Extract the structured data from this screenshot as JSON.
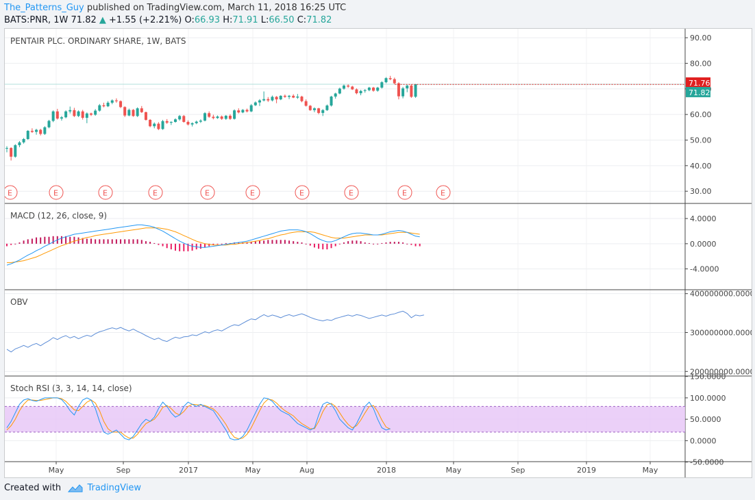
{
  "header": {
    "author": "The_Patterns_Guy",
    "published": "published on TradingView.com, March 11, 2018 16:25 UTC",
    "symbol": "BATS:PNR, 1W",
    "last": "71.82",
    "change": "+1.55 (+2.21%)",
    "o_label": "O:",
    "o_val": "66.93",
    "h_label": "H:",
    "h_val": "71.91",
    "l_label": "L:",
    "l_val": "66.50",
    "c_label": "C:",
    "c_val": "71.82"
  },
  "footer": {
    "created": "Created with",
    "brand": "TradingView"
  },
  "colors": {
    "up": "#26a69a",
    "down": "#ef5350",
    "macd": "#2196f3",
    "signal": "#ff9800",
    "hist_neg": "#e91e63",
    "hist_pos": "#c2185b",
    "obv": "#5b8cd6",
    "band_fill": "#e7c8f7",
    "band_line": "#9c5fc2",
    "earnings": "#ef5350",
    "last_price": "#26a69a",
    "prev_close": "#e02020"
  },
  "chart_data": [
    {
      "pane": "price",
      "type": "candlestick",
      "title": "PENTAIR PLC. ORDINARY SHARE, 1W, BATS",
      "y_ticks": [
        "90.00",
        "80.00",
        "70.00",
        "60.00",
        "50.00",
        "40.00",
        "30.00"
      ],
      "y_values": [
        90,
        80,
        70,
        60,
        50,
        40,
        30
      ],
      "ylim": [
        25.5,
        93.5
      ],
      "x_ticks": [
        "May",
        "Sep",
        "2017",
        "May",
        "Aug",
        "2018",
        "May",
        "Sep",
        "2019",
        "May"
      ],
      "last_price_label": "71.82",
      "prev_close_label": "71.76",
      "earnings_marker": "E",
      "earnings_count": 10,
      "candles": [
        [
          46.8,
          47.6,
          45.2,
          46.9
        ],
        [
          46.9,
          47.2,
          42.0,
          43.5
        ],
        [
          43.5,
          48.4,
          43.1,
          48.0
        ],
        [
          48.0,
          49.6,
          47.2,
          49.1
        ],
        [
          49.1,
          50.8,
          48.6,
          50.4
        ],
        [
          50.4,
          53.9,
          50.1,
          53.6
        ],
        [
          53.6,
          54.6,
          52.8,
          53.2
        ],
        [
          53.2,
          54.4,
          52.1,
          54.0
        ],
        [
          54.0,
          54.4,
          51.8,
          52.4
        ],
        [
          52.4,
          55.4,
          52.0,
          55.0
        ],
        [
          55.0,
          57.9,
          54.6,
          57.5
        ],
        [
          57.5,
          61.6,
          57.0,
          61.2
        ],
        [
          61.2,
          62.2,
          58.0,
          58.4
        ],
        [
          58.4,
          59.4,
          57.6,
          58.9
        ],
        [
          58.9,
          61.6,
          58.5,
          61.2
        ],
        [
          61.2,
          63.1,
          60.4,
          61.7
        ],
        [
          61.7,
          62.6,
          59.0,
          59.4
        ],
        [
          59.4,
          61.6,
          59.0,
          61.2
        ],
        [
          61.2,
          61.8,
          58.0,
          58.7
        ],
        [
          58.7,
          60.8,
          56.6,
          60.4
        ],
        [
          60.4,
          60.7,
          59.4,
          59.9
        ],
        [
          59.9,
          62.1,
          59.5,
          61.5
        ],
        [
          61.5,
          64.1,
          61.1,
          63.6
        ],
        [
          63.6,
          64.6,
          62.8,
          63.2
        ],
        [
          63.2,
          65.2,
          62.9,
          64.6
        ],
        [
          64.6,
          65.9,
          64.0,
          65.5
        ],
        [
          65.5,
          66.3,
          64.6,
          65.2
        ],
        [
          65.2,
          65.5,
          62.5,
          62.9
        ],
        [
          62.9,
          63.2,
          59.0,
          59.6
        ],
        [
          59.6,
          62.3,
          59.3,
          61.8
        ],
        [
          61.8,
          62.1,
          59.1,
          59.4
        ],
        [
          59.4,
          62.8,
          59.0,
          62.4
        ],
        [
          62.4,
          63.3,
          60.6,
          60.9
        ],
        [
          60.9,
          61.1,
          57.6,
          57.9
        ],
        [
          57.9,
          58.2,
          55.0,
          55.4
        ],
        [
          55.4,
          56.9,
          54.6,
          56.4
        ],
        [
          56.4,
          57.0,
          53.9,
          54.3
        ],
        [
          54.3,
          57.9,
          54.0,
          57.4
        ],
        [
          57.4,
          58.2,
          56.3,
          56.8
        ],
        [
          56.8,
          57.3,
          55.9,
          57.1
        ],
        [
          57.1,
          58.5,
          56.8,
          58.1
        ],
        [
          58.1,
          59.8,
          57.6,
          59.4
        ],
        [
          59.4,
          59.8,
          56.8,
          57.1
        ],
        [
          57.1,
          57.7,
          55.7,
          56.1
        ],
        [
          56.1,
          56.9,
          55.3,
          56.6
        ],
        [
          56.6,
          57.6,
          56.2,
          57.2
        ],
        [
          57.2,
          58.1,
          56.7,
          57.6
        ],
        [
          57.6,
          60.9,
          57.3,
          60.5
        ],
        [
          60.5,
          61.2,
          58.7,
          59.1
        ],
        [
          59.1,
          59.9,
          58.1,
          58.6
        ],
        [
          58.6,
          59.6,
          58.3,
          59.2
        ],
        [
          59.2,
          59.6,
          57.9,
          58.3
        ],
        [
          58.3,
          59.8,
          57.9,
          59.5
        ],
        [
          59.5,
          60.1,
          57.9,
          58.3
        ],
        [
          58.3,
          62.0,
          58.0,
          61.6
        ],
        [
          61.6,
          62.4,
          60.4,
          60.8
        ],
        [
          60.8,
          62.1,
          60.5,
          61.8
        ],
        [
          61.8,
          62.3,
          60.8,
          61.2
        ],
        [
          61.2,
          64.1,
          60.9,
          63.6
        ],
        [
          63.6,
          65.1,
          63.3,
          64.7
        ],
        [
          64.7,
          66.0,
          63.3,
          65.5
        ],
        [
          65.5,
          69.0,
          65.1,
          66.0
        ],
        [
          66.0,
          66.8,
          64.9,
          65.5
        ],
        [
          65.5,
          67.4,
          65.1,
          66.9
        ],
        [
          66.9,
          67.2,
          64.4,
          65.9
        ],
        [
          65.9,
          67.5,
          65.6,
          67.3
        ],
        [
          67.3,
          67.8,
          66.5,
          66.9
        ],
        [
          66.9,
          67.6,
          66.0,
          67.3
        ],
        [
          67.3,
          67.9,
          66.4,
          66.6
        ],
        [
          66.6,
          68.0,
          66.1,
          67.0
        ],
        [
          67.0,
          67.3,
          64.8,
          65.2
        ],
        [
          65.2,
          65.9,
          63.1,
          63.4
        ],
        [
          63.4,
          63.7,
          61.4,
          61.7
        ],
        [
          61.7,
          62.8,
          60.9,
          62.4
        ],
        [
          62.4,
          62.6,
          60.1,
          60.6
        ],
        [
          60.6,
          62.1,
          59.4,
          61.7
        ],
        [
          61.7,
          63.9,
          61.4,
          63.5
        ],
        [
          63.5,
          67.3,
          63.1,
          67.0
        ],
        [
          67.0,
          68.5,
          66.2,
          68.2
        ],
        [
          68.2,
          70.5,
          67.9,
          70.1
        ],
        [
          70.1,
          71.7,
          69.7,
          71.3
        ],
        [
          71.3,
          71.8,
          70.4,
          70.9
        ],
        [
          70.9,
          71.2,
          69.6,
          69.8
        ],
        [
          69.8,
          70.2,
          67.9,
          68.3
        ],
        [
          68.3,
          69.6,
          67.5,
          69.2
        ],
        [
          69.2,
          69.9,
          68.5,
          69.5
        ],
        [
          69.5,
          70.8,
          69.1,
          70.5
        ],
        [
          70.5,
          70.8,
          68.9,
          69.3
        ],
        [
          69.3,
          70.8,
          68.9,
          70.5
        ],
        [
          70.5,
          73.0,
          70.1,
          72.6
        ],
        [
          72.6,
          74.6,
          72.2,
          74.2
        ],
        [
          74.2,
          75.1,
          73.4,
          73.8
        ],
        [
          73.8,
          74.4,
          71.8,
          72.2
        ],
        [
          72.2,
          72.6,
          65.9,
          67.1
        ],
        [
          67.1,
          70.8,
          66.3,
          70.2
        ],
        [
          70.2,
          71.6,
          68.7,
          71.3
        ],
        [
          71.3,
          71.8,
          66.5,
          66.9
        ],
        [
          66.93,
          71.91,
          66.5,
          71.82
        ]
      ]
    },
    {
      "pane": "macd",
      "type": "line",
      "title": "MACD (12, 26, close, 9)",
      "y_ticks": [
        "4.0000",
        "0.0000",
        "-4.0000"
      ],
      "y_values": [
        4,
        0,
        -4
      ],
      "ylim": [
        -7.2,
        6.4
      ],
      "series": [
        {
          "key": "macd",
          "values": [
            -3.4,
            -3.2,
            -2.9,
            -2.6,
            -2.2,
            -1.8,
            -1.5,
            -1.1,
            -0.8,
            -0.4,
            -0.1,
            0.3,
            0.6,
            0.9,
            1.1,
            1.3,
            1.5,
            1.6,
            1.7,
            1.8,
            1.9,
            2.0,
            2.1,
            2.2,
            2.3,
            2.4,
            2.5,
            2.6,
            2.7,
            2.8,
            2.9,
            3.0,
            3.0,
            2.9,
            2.8,
            2.6,
            2.3,
            2.0,
            1.6,
            1.2,
            0.8,
            0.4,
            0.1,
            -0.2,
            -0.4,
            -0.5,
            -0.6,
            -0.6,
            -0.5,
            -0.4,
            -0.3,
            -0.2,
            -0.1,
            0.0,
            0.1,
            0.2,
            0.3,
            0.4,
            0.6,
            0.8,
            1.0,
            1.2,
            1.4,
            1.6,
            1.8,
            2.0,
            2.1,
            2.2,
            2.2,
            2.2,
            2.1,
            1.9,
            1.6,
            1.2,
            0.8,
            0.5,
            0.3,
            0.3,
            0.5,
            0.8,
            1.1,
            1.4,
            1.6,
            1.7,
            1.7,
            1.6,
            1.5,
            1.4,
            1.4,
            1.5,
            1.7,
            1.9,
            2.0,
            2.1,
            2.0,
            1.8,
            1.5,
            1.2,
            1.1
          ]
        },
        {
          "key": "signal",
          "values": [
            -3.0,
            -3.0,
            -2.9,
            -2.8,
            -2.7,
            -2.5,
            -2.3,
            -2.1,
            -1.8,
            -1.5,
            -1.2,
            -0.9,
            -0.6,
            -0.3,
            -0.1,
            0.2,
            0.4,
            0.6,
            0.8,
            1.0,
            1.1,
            1.3,
            1.4,
            1.5,
            1.6,
            1.7,
            1.8,
            1.9,
            2.0,
            2.1,
            2.2,
            2.3,
            2.4,
            2.5,
            2.5,
            2.5,
            2.5,
            2.4,
            2.3,
            2.1,
            1.9,
            1.6,
            1.3,
            1.0,
            0.7,
            0.4,
            0.2,
            0.0,
            -0.1,
            -0.2,
            -0.2,
            -0.2,
            -0.2,
            -0.1,
            -0.1,
            0.0,
            0.1,
            0.2,
            0.3,
            0.4,
            0.5,
            0.7,
            0.8,
            1.0,
            1.2,
            1.4,
            1.5,
            1.7,
            1.8,
            1.9,
            1.9,
            1.9,
            1.9,
            1.8,
            1.6,
            1.4,
            1.2,
            1.0,
            0.9,
            0.9,
            0.9,
            1.0,
            1.1,
            1.2,
            1.3,
            1.4,
            1.4,
            1.4,
            1.4,
            1.4,
            1.5,
            1.6,
            1.7,
            1.8,
            1.8,
            1.8,
            1.7,
            1.6,
            1.5
          ]
        }
      ]
    },
    {
      "pane": "obv",
      "type": "line",
      "title": "OBV",
      "y_ticks": [
        "400000000.0000",
        "300000000.0000",
        "200000000.0000"
      ],
      "y_values": [
        400000000,
        300000000,
        200000000
      ],
      "ylim": [
        190000000,
        410000000
      ],
      "series": [
        {
          "key": "obv",
          "values": [
            257,
            250,
            258,
            262,
            267,
            262,
            268,
            272,
            266,
            273,
            279,
            287,
            282,
            288,
            292,
            286,
            290,
            284,
            289,
            293,
            290,
            297,
            302,
            305,
            309,
            312,
            309,
            313,
            308,
            304,
            309,
            303,
            298,
            292,
            287,
            282,
            286,
            280,
            277,
            283,
            288,
            285,
            289,
            290,
            294,
            292,
            297,
            302,
            299,
            304,
            307,
            304,
            310,
            316,
            320,
            318,
            324,
            330,
            335,
            333,
            340,
            346,
            341,
            345,
            342,
            338,
            343,
            346,
            342,
            345,
            348,
            344,
            339,
            335,
            332,
            330,
            333,
            331,
            336,
            339,
            342,
            345,
            342,
            346,
            344,
            340,
            336,
            339,
            342,
            345,
            342,
            346,
            348,
            352,
            355,
            349,
            338,
            345,
            343,
            345
          ]
        }
      ]
    },
    {
      "pane": "stoch_rsi",
      "type": "line",
      "title": "Stoch RSI (3, 3, 14, 14, close)",
      "y_ticks": [
        "150.0000",
        "100.0000",
        "50.0000",
        "0.0000",
        "-50.0000"
      ],
      "y_values": [
        150,
        100,
        50,
        0,
        -50
      ],
      "ylim": [
        -49,
        151
      ],
      "band": [
        20,
        80
      ],
      "series": [
        {
          "key": "k",
          "values": [
            30,
            45,
            65,
            85,
            95,
            98,
            94,
            92,
            96,
            100,
            100,
            100,
            100,
            96,
            85,
            70,
            60,
            80,
            95,
            100,
            95,
            75,
            45,
            20,
            15,
            20,
            25,
            15,
            5,
            2,
            10,
            25,
            40,
            50,
            45,
            55,
            75,
            90,
            80,
            65,
            55,
            60,
            80,
            90,
            85,
            80,
            85,
            80,
            75,
            70,
            55,
            40,
            25,
            5,
            2,
            3,
            10,
            25,
            45,
            65,
            85,
            100,
            98,
            92,
            80,
            70,
            65,
            60,
            50,
            40,
            35,
            30,
            25,
            30,
            60,
            85,
            90,
            85,
            70,
            50,
            40,
            30,
            25,
            40,
            60,
            80,
            90,
            75,
            50,
            30,
            25,
            28
          ]
        },
        {
          "key": "d",
          "values": [
            25,
            35,
            50,
            70,
            85,
            95,
            95,
            94,
            94,
            96,
            98,
            100,
            100,
            98,
            92,
            82,
            72,
            70,
            80,
            90,
            95,
            88,
            70,
            45,
            28,
            20,
            20,
            20,
            12,
            6,
            6,
            15,
            28,
            40,
            45,
            50,
            62,
            78,
            82,
            75,
            65,
            60,
            68,
            80,
            85,
            84,
            83,
            82,
            78,
            74,
            65,
            52,
            38,
            20,
            8,
            4,
            6,
            15,
            30,
            50,
            70,
            88,
            97,
            95,
            88,
            78,
            70,
            64,
            58,
            48,
            40,
            34,
            28,
            28,
            45,
            68,
            84,
            87,
            80,
            65,
            50,
            38,
            30,
            35,
            48,
            65,
            80,
            82,
            68,
            48,
            32,
            27
          ]
        }
      ]
    }
  ]
}
